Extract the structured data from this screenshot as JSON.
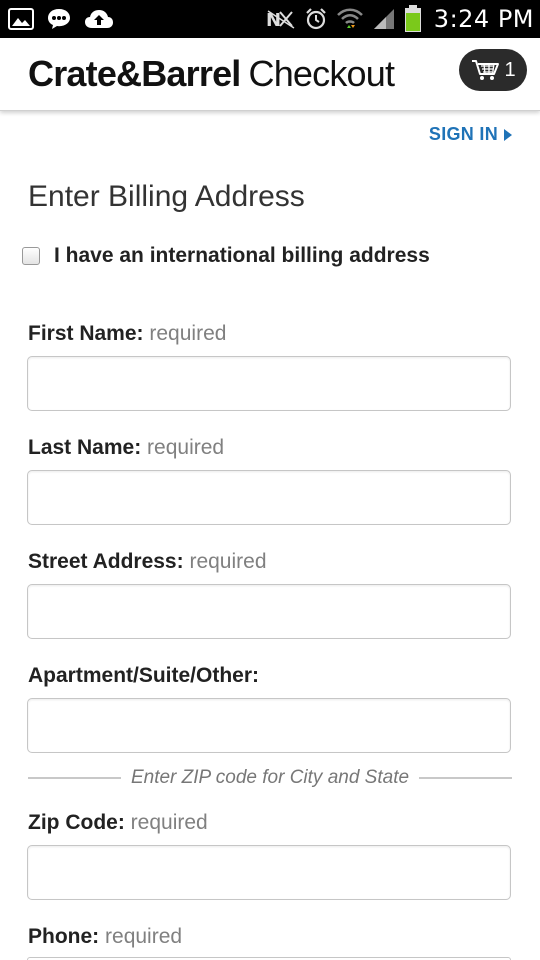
{
  "status_bar": {
    "time": "3:24 PM",
    "left_icons": [
      "image-icon",
      "chat-icon",
      "cloud-upload-icon"
    ],
    "right_icons": [
      "nfc-off-icon",
      "alarm-icon",
      "wifi-icon",
      "signal-icon",
      "battery-icon"
    ]
  },
  "header": {
    "brand": "Crate&Barrel",
    "page_name": "Checkout",
    "cart_count": "1",
    "cart_icon": "cart-icon"
  },
  "sign_in": {
    "label": "SIGN IN"
  },
  "form": {
    "title": "Enter Billing Address",
    "international_label": "I have an international billing address",
    "international_checked": false,
    "fields": [
      {
        "label": "First Name:",
        "note": "required",
        "value": ""
      },
      {
        "label": "Last Name:",
        "note": "required",
        "value": ""
      },
      {
        "label": "Street Address:",
        "note": "required",
        "value": ""
      },
      {
        "label": "Apartment/Suite/Other:",
        "note": "",
        "value": ""
      },
      {
        "label": "Zip Code:",
        "note": "required",
        "value": ""
      },
      {
        "label": "Phone:",
        "note": "required",
        "value": ""
      }
    ],
    "zip_divider": "Enter ZIP code for City and State"
  },
  "colors": {
    "accent": "#1f73b7",
    "status_bar_bg": "#000000",
    "cart_bg": "#2b2b2b",
    "battery": "#7bc91b"
  }
}
